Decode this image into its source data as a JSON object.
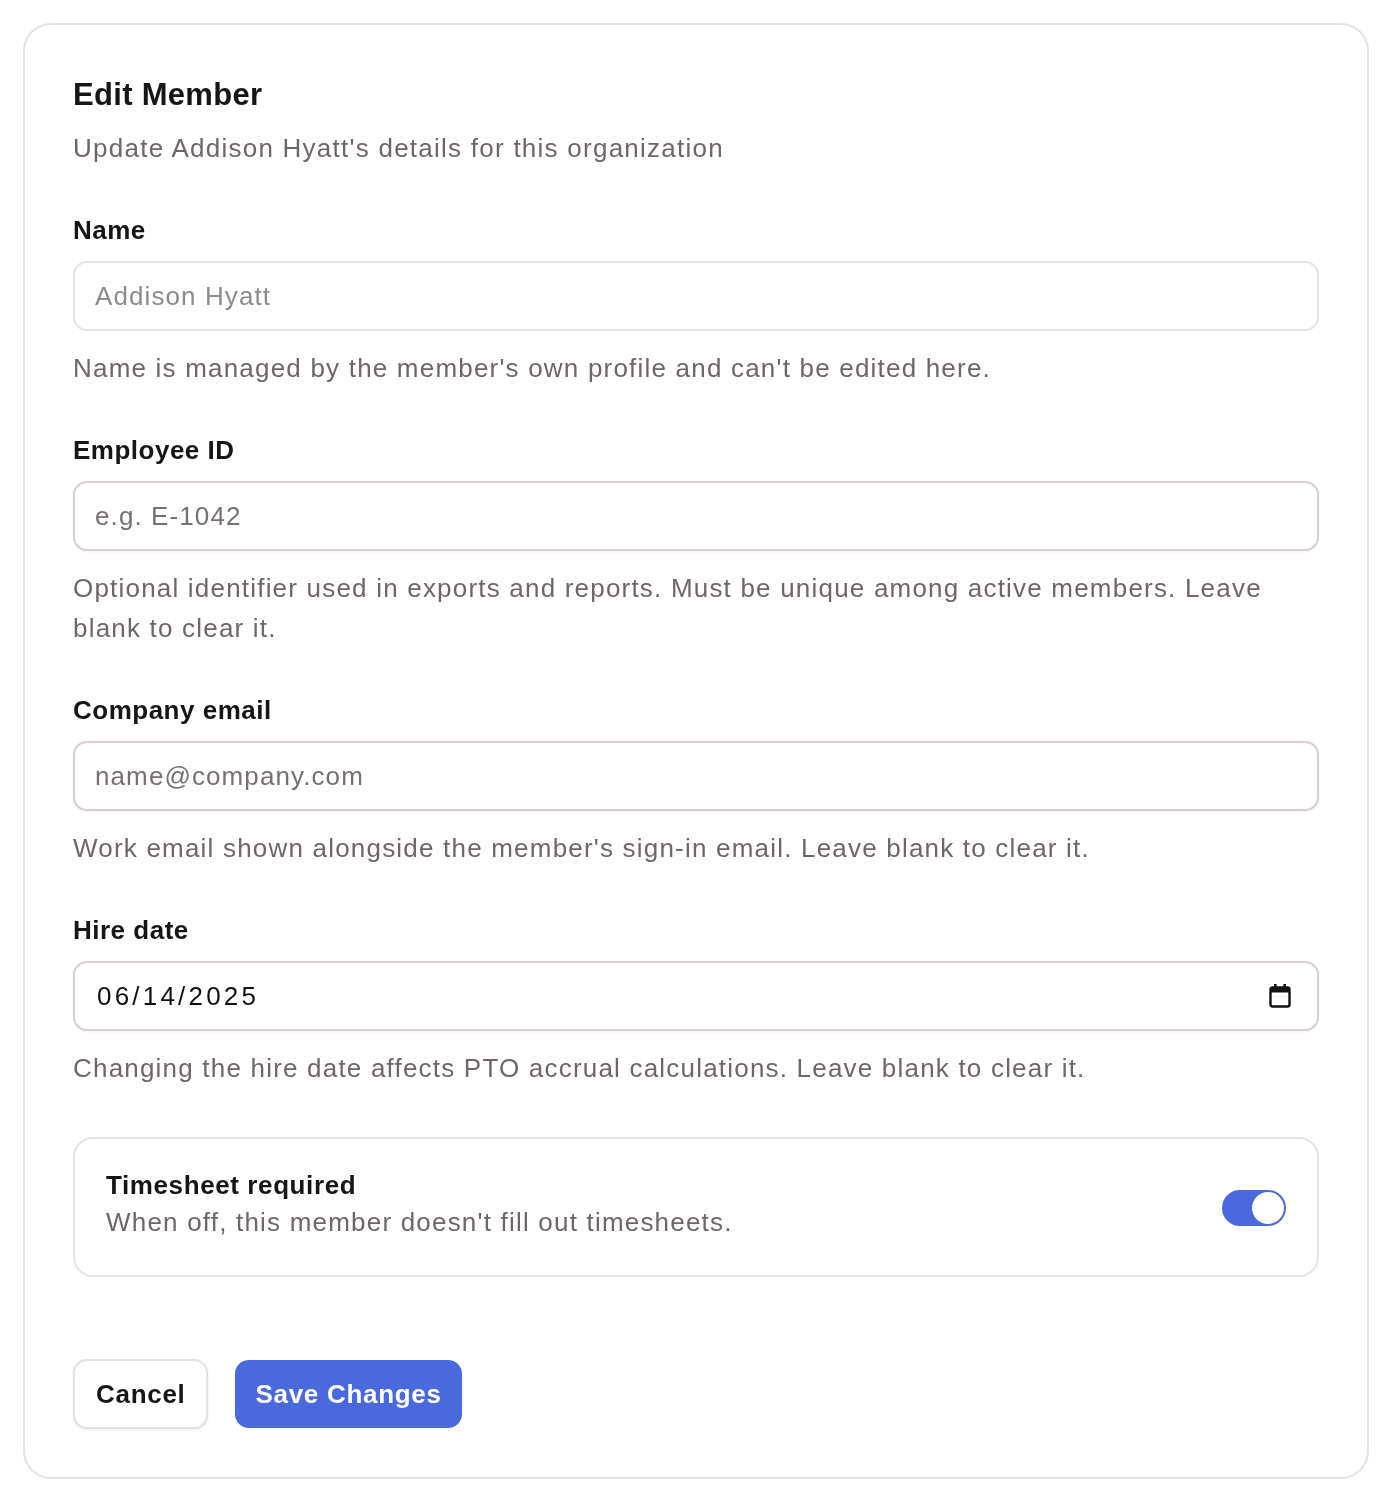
{
  "dialog": {
    "title": "Edit Member",
    "subtitle": "Update Addison Hyatt's details for this organization"
  },
  "fields": [
    {
      "kind": "text",
      "label": "Name",
      "value": "Addison Hyatt",
      "disabled": true,
      "helper": "Name is managed by the member's own profile and can't be edited here."
    },
    {
      "kind": "text",
      "label": "Employee ID",
      "placeholder": "e.g. E-1042",
      "disabled": false,
      "helper": "Optional identifier used in exports and reports. Must be unique among active members. Leave blank to clear it."
    },
    {
      "kind": "text",
      "label": "Company email",
      "placeholder": "name@company.com",
      "disabled": false,
      "helper": "Work email shown alongside the member's sign-in email. Leave blank to clear it."
    },
    {
      "kind": "date",
      "label": "Hire date",
      "value": "06/14/2025",
      "disabled": false,
      "helper": "Changing the hire date affects PTO accrual calculations. Leave blank to clear it."
    }
  ],
  "setting": {
    "title": "Timesheet required",
    "description": "When off, this member doesn't fill out timesheets.",
    "on": true
  },
  "buttons": [
    {
      "kind": "secondary",
      "label": "Cancel"
    },
    {
      "kind": "primary",
      "label": "Save Changes"
    }
  ]
}
